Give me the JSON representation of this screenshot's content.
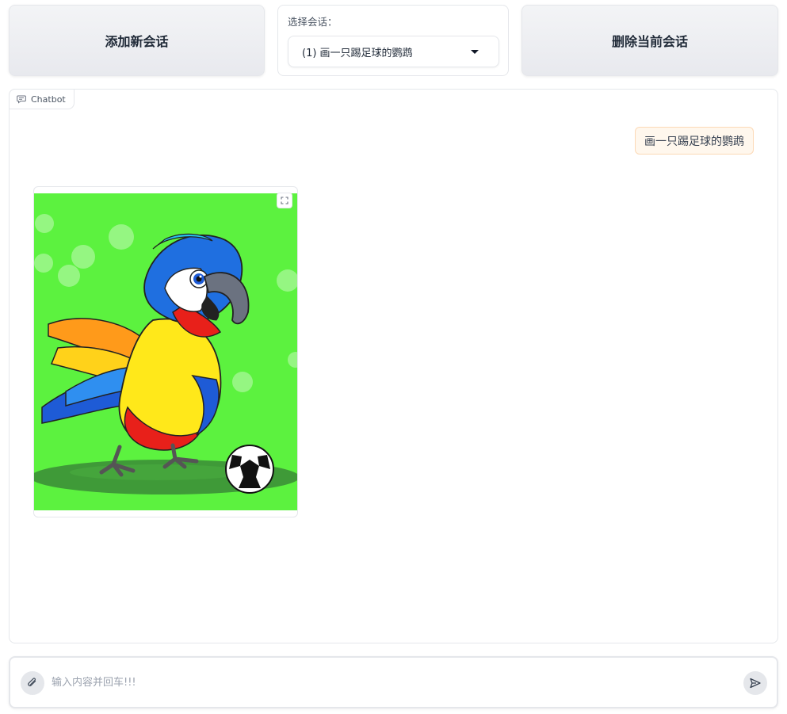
{
  "toolbar": {
    "add_label": "添加新会话",
    "select_label": "选择会话：",
    "select_value": "(1)  画一只踢足球的鹦鹉",
    "delete_label": "删除当前会话"
  },
  "chatbot": {
    "label": "Chatbot",
    "user_message": "画一只踢足球的鹦鹉",
    "image_alt": "parrot playing football illustration"
  },
  "composer": {
    "placeholder": "输入内容并回车!!!"
  },
  "icons": {
    "chat": "chat-bubble-icon",
    "expand": "fullscreen-icon",
    "attach": "paperclip-icon",
    "send": "send-arrow-icon",
    "dropdown": "caret-down-icon"
  },
  "colors": {
    "image_background": "#5cf23f",
    "user_bubble_bg": "#fff7ed",
    "user_bubble_border": "#fcd9b6"
  }
}
